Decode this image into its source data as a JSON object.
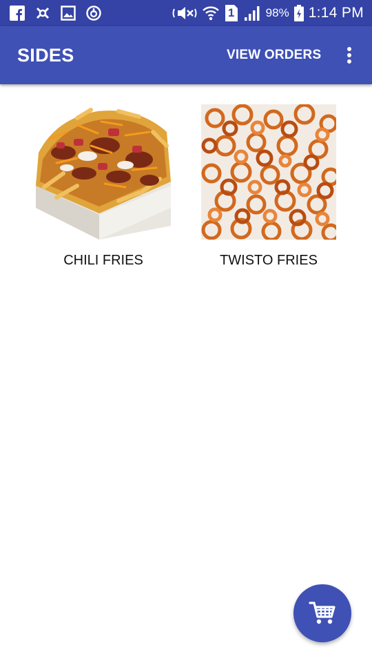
{
  "status_bar": {
    "icons_left": [
      "facebook-icon",
      "settings-sync-icon",
      "gallery-icon",
      "power-saving-icon"
    ],
    "icons_right": [
      "mute-icon",
      "wifi-icon",
      "sim-icon",
      "signal-icon",
      "battery-icon"
    ],
    "sim_number": "1",
    "battery_text": "98%",
    "time": "1:14 PM",
    "bar_color": "#3443a5"
  },
  "app_bar": {
    "title": "SIDES",
    "action_label": "VIEW ORDERS",
    "overflow_icon": "more-vert-icon",
    "color": "#3f51b5"
  },
  "items": [
    {
      "name": "CHILI FRIES"
    },
    {
      "name": "TWISTO FRIES"
    }
  ],
  "fab": {
    "icon": "shopping-cart-icon",
    "color": "#3f51b5"
  }
}
